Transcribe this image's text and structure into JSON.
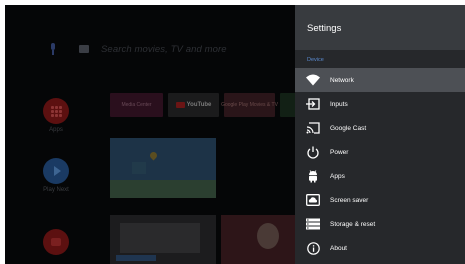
{
  "launcher": {
    "search_hint": "Search movies, TV and more",
    "rail": [
      {
        "label": "Apps",
        "icon": "apps-icon"
      },
      {
        "label": "Play Next",
        "icon": "play-icon"
      },
      {
        "label": "",
        "icon": "youtube-icon"
      }
    ],
    "tiles": [
      {
        "label": "Media Center"
      },
      {
        "label": "YouTube"
      },
      {
        "label": "Google Play Movies & TV"
      },
      {
        "label": ""
      }
    ]
  },
  "settings": {
    "title": "Settings",
    "section": "Device",
    "items": [
      {
        "label": "Network",
        "icon": "wifi-icon",
        "selected": true
      },
      {
        "label": "Inputs",
        "icon": "input-icon"
      },
      {
        "label": "Google Cast",
        "icon": "cast-icon"
      },
      {
        "label": "Power",
        "icon": "power-icon"
      },
      {
        "label": "Apps",
        "icon": "android-icon"
      },
      {
        "label": "Screen saver",
        "icon": "screen-saver-icon"
      },
      {
        "label": "Storage & reset",
        "icon": "storage-icon"
      },
      {
        "label": "About",
        "icon": "info-icon"
      }
    ]
  },
  "colors": {
    "panel_bg": "#26282b",
    "panel_header": "#383b3f",
    "selected_row": "#4d5055",
    "section_accent": "#5b8bd0"
  }
}
